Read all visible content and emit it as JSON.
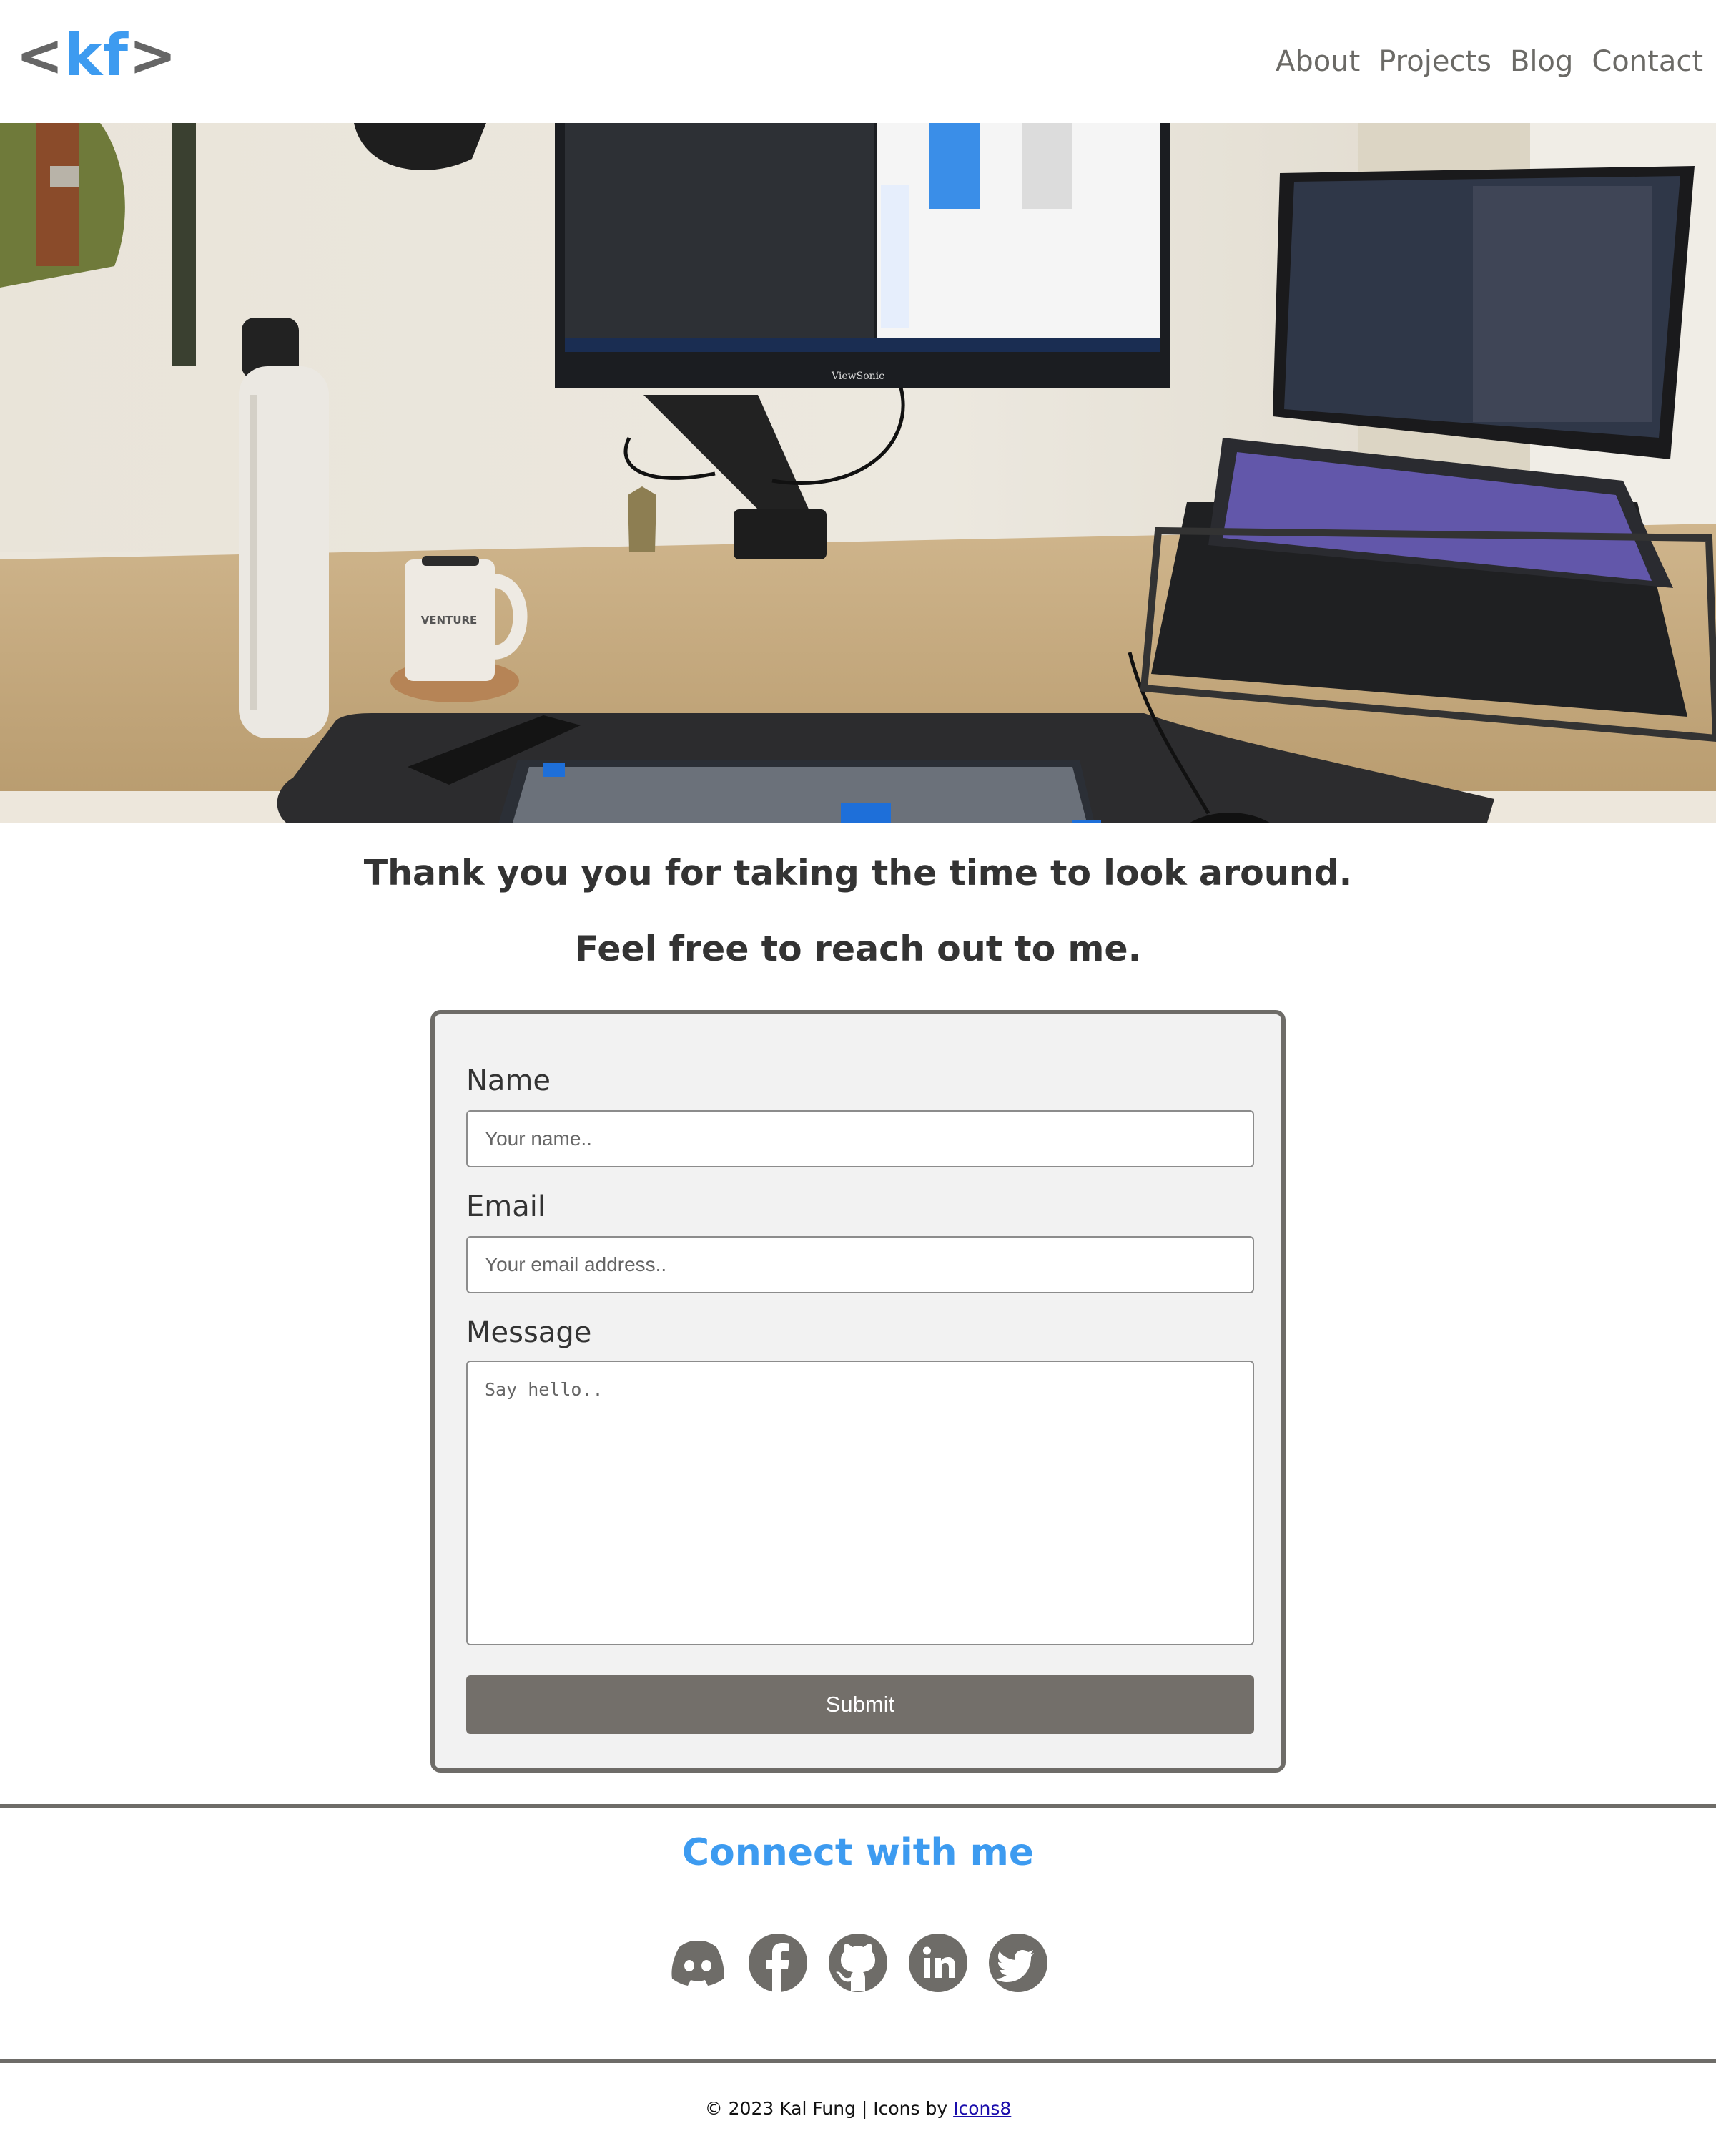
{
  "brand": {
    "open": "<",
    "name": "kf",
    "close": ">",
    "accent": "#3d9bf0"
  },
  "nav": {
    "items": [
      "About",
      "Projects",
      "Blog",
      "Contact"
    ]
  },
  "hero": {
    "monitor_brand": "ViewSonic",
    "mug_text": "VENTURE"
  },
  "intro": {
    "thanks": "Thank you you for taking the time to look around.",
    "reach": "Feel free to reach out to me."
  },
  "form": {
    "name_label": "Name",
    "name_placeholder": "Your name..",
    "email_label": "Email",
    "email_placeholder": "Your email address..",
    "message_label": "Message",
    "message_placeholder": "Say hello..",
    "submit_label": "Submit"
  },
  "connect": {
    "title": "Connect with me",
    "icons": [
      "discord-icon",
      "facebook-icon",
      "github-icon",
      "linkedin-icon",
      "twitter-icon"
    ]
  },
  "footer": {
    "text": "© 2023 Kal Fung | Icons by ",
    "link": "Icons8"
  },
  "colors": {
    "accent": "#3d9bf0",
    "gray": "#6e6c68",
    "button": "#736f6a"
  }
}
